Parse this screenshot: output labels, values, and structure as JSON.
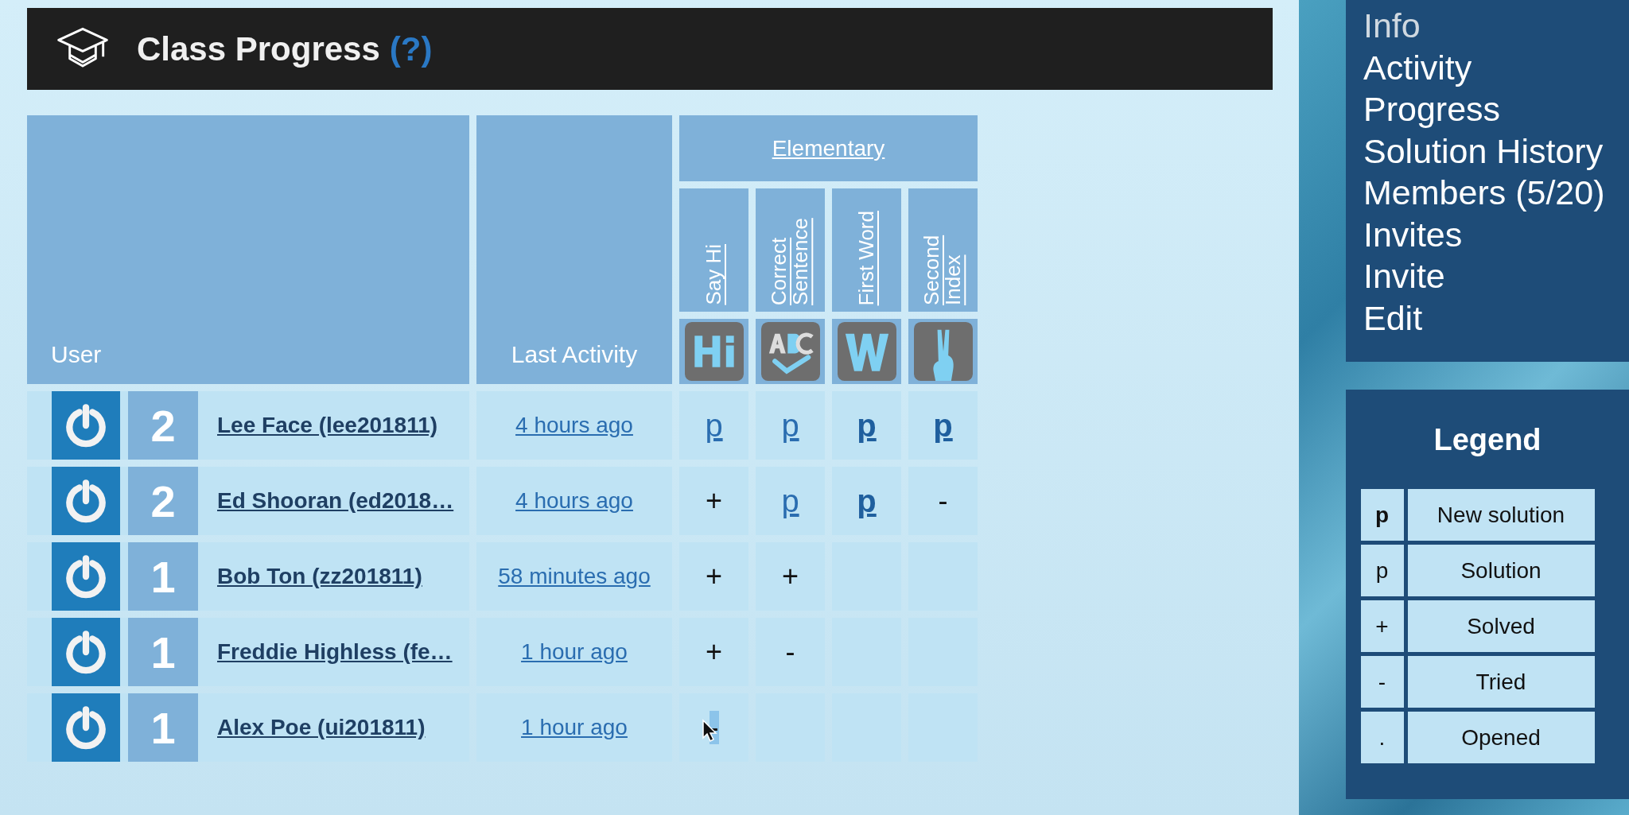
{
  "header": {
    "title": "Class Progress",
    "help": "(?)"
  },
  "table": {
    "columns": {
      "user": "User",
      "last_activity": "Last Activity",
      "group": "Elementary"
    },
    "exercises": [
      {
        "title": "Say Hi"
      },
      {
        "title": "Correct Sentence"
      },
      {
        "title": "First Word"
      },
      {
        "title": "Second Index"
      }
    ],
    "rows": [
      {
        "level": "2",
        "name": "Lee Face (lee201811)",
        "last_activity": "4 hours ago",
        "cells": [
          {
            "kind": "solution",
            "mark": "p",
            "hovered": false
          },
          {
            "kind": "solution",
            "mark": "p",
            "hovered": false
          },
          {
            "kind": "new",
            "mark": "p",
            "hovered": false
          },
          {
            "kind": "new",
            "mark": "p",
            "hovered": false
          }
        ]
      },
      {
        "level": "2",
        "name": "Ed Shooran (ed2018…",
        "last_activity": "4 hours ago",
        "cells": [
          {
            "kind": "solved",
            "mark": "+",
            "hovered": false
          },
          {
            "kind": "solution",
            "mark": "p",
            "hovered": false
          },
          {
            "kind": "new",
            "mark": "p",
            "hovered": false
          },
          {
            "kind": "tried",
            "mark": "-",
            "hovered": false
          }
        ]
      },
      {
        "level": "1",
        "name": "Bob Ton (zz201811)",
        "last_activity": "58 minutes ago",
        "cells": [
          {
            "kind": "solved",
            "mark": "+",
            "hovered": false
          },
          {
            "kind": "solved",
            "mark": "+",
            "hovered": false
          },
          {
            "hovered": false
          },
          {
            "hovered": false
          }
        ]
      },
      {
        "level": "1",
        "name": "Freddie Highless (fe…",
        "last_activity": "1 hour ago",
        "cells": [
          {
            "kind": "solved",
            "mark": "+",
            "hovered": false
          },
          {
            "kind": "tried",
            "mark": "-",
            "hovered": false
          },
          {
            "hovered": false
          },
          {
            "hovered": false
          }
        ]
      },
      {
        "level": "1",
        "name": "Alex Poe (ui201811)",
        "last_activity": "1 hour ago",
        "cells": [
          {
            "kind": "tried",
            "mark": "-",
            "hovered": true
          },
          {
            "hovered": false
          },
          {
            "hovered": false
          },
          {
            "hovered": false
          }
        ]
      }
    ]
  },
  "sidebar": {
    "items": [
      "Info",
      "Activity",
      "Progress",
      "Solution History",
      "Members (5/20)",
      "Invites",
      "Invite",
      "Edit"
    ]
  },
  "legend": {
    "title": "Legend",
    "items": [
      {
        "kind": "new",
        "symbol": "p",
        "label": "New solution"
      },
      {
        "kind": "solution",
        "symbol": "p",
        "label": "Solution"
      },
      {
        "kind": "solved",
        "symbol": "+",
        "label": "Solved"
      },
      {
        "kind": "tried",
        "symbol": "-",
        "label": "Tried"
      },
      {
        "kind": "opened",
        "symbol": ".",
        "label": "Opened"
      }
    ]
  }
}
